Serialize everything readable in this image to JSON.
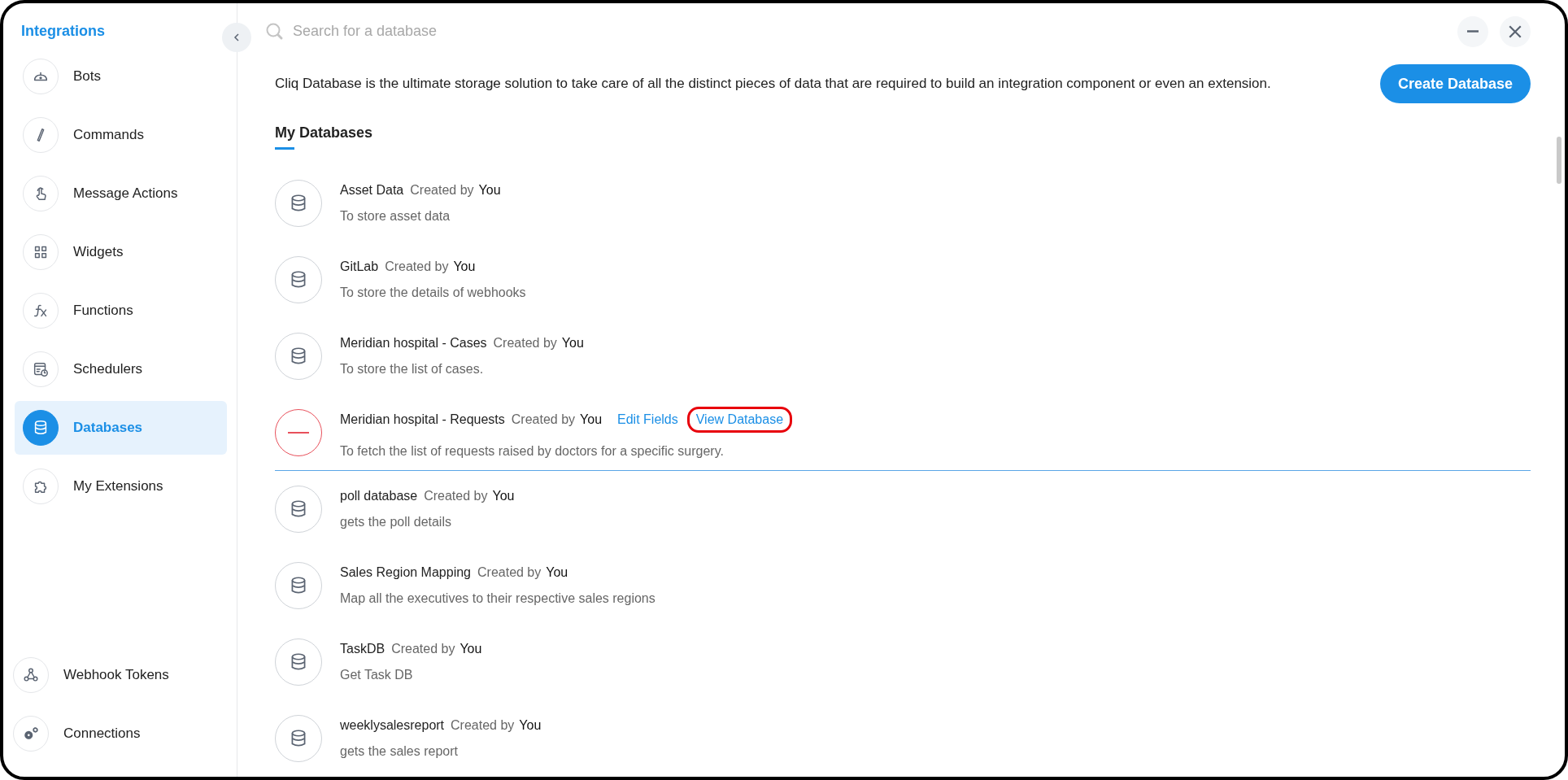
{
  "sidebar": {
    "title": "Integrations",
    "items": [
      {
        "label": "Bots",
        "kind": "bot",
        "selected": false
      },
      {
        "label": "Commands",
        "kind": "slash",
        "selected": false
      },
      {
        "label": "Message Actions",
        "kind": "hand",
        "selected": false
      },
      {
        "label": "Widgets",
        "kind": "grid",
        "selected": false
      },
      {
        "label": "Functions",
        "kind": "fx",
        "selected": false
      },
      {
        "label": "Schedulers",
        "kind": "calendar",
        "selected": false
      },
      {
        "label": "Databases",
        "kind": "database",
        "selected": true
      },
      {
        "label": "My Extensions",
        "kind": "puzzle",
        "selected": false
      }
    ],
    "bottom_items": [
      {
        "label": "Webhook Tokens",
        "kind": "webhook",
        "selected": false
      },
      {
        "label": "Connections",
        "kind": "gears",
        "selected": false
      }
    ]
  },
  "search": {
    "placeholder": "Search for a database"
  },
  "description": "Cliq Database is the ultimate storage solution to take care of all the distinct pieces of data that are required to build an integration component or even an extension.",
  "create_button": "Create Database",
  "section_title": "My Databases",
  "databases": [
    {
      "name": "Asset Data",
      "created_by": "Created by",
      "creator": "You",
      "description": "To store asset data",
      "hovered": false
    },
    {
      "name": "GitLab",
      "created_by": "Created by",
      "creator": "You",
      "description": "To store the details of webhooks",
      "hovered": false
    },
    {
      "name": "Meridian hospital - Cases",
      "created_by": "Created by",
      "creator": "You",
      "description": "To store the list of cases.",
      "hovered": false
    },
    {
      "name": "Meridian hospital - Requests",
      "created_by": "Created by",
      "creator": "You",
      "description": "To fetch the list of requests raised by doctors for a specific surgery.",
      "hovered": true,
      "actions": [
        {
          "label": "Edit Fields",
          "highlighted": false
        },
        {
          "label": "View Database",
          "highlighted": true
        }
      ]
    },
    {
      "name": "poll database",
      "created_by": "Created by",
      "creator": "You",
      "description": "gets the poll details",
      "hovered": false
    },
    {
      "name": "Sales Region Mapping",
      "created_by": "Created by",
      "creator": "You",
      "description": "Map all the executives to their respective sales regions",
      "hovered": false
    },
    {
      "name": "TaskDB",
      "created_by": "Created by",
      "creator": "You",
      "description": "Get Task DB",
      "hovered": false
    },
    {
      "name": "weeklysalesreport",
      "created_by": "Created by",
      "creator": "You",
      "description": "gets the sales report",
      "hovered": false
    }
  ]
}
